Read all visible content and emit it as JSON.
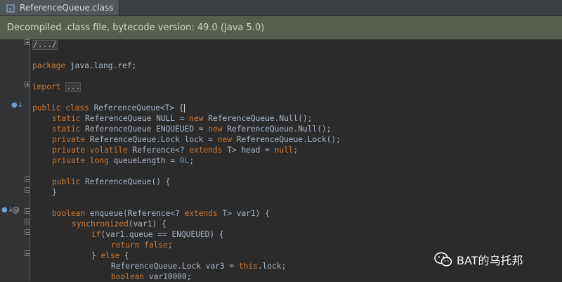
{
  "tab": {
    "label": "ReferenceQueue.class",
    "icon": "java-class-file-icon"
  },
  "banner": {
    "text": "Decompiled .class file, bytecode version: 49.0 (Java 5.0)"
  },
  "colors": {
    "keyword": "#cc7832",
    "identifier": "#a9b7c6",
    "number": "#6897bb",
    "banner_bg": "#565f4b",
    "editor_bg": "#2b2b2b"
  },
  "code": {
    "l1": "/.../",
    "l2_kw": "package",
    "l2_rest": " java.lang.ref;",
    "l3_kw": "import",
    "l3_rest": "...",
    "l4_kw": "public class",
    "l4_rest": " ReferenceQueue<T> {",
    "l5_kw1": "static",
    "l5_mid": " ReferenceQueue NULL = ",
    "l5_kw2": "new",
    "l5_rest": " ReferenceQueue.Null();",
    "l6_kw1": "static",
    "l6_mid": " ReferenceQueue ENQUEUED = ",
    "l6_kw2": "new",
    "l6_rest": " ReferenceQueue.Null();",
    "l7_kw1": "private",
    "l7_mid": " ReferenceQueue.Lock lock = ",
    "l7_kw2": "new",
    "l7_rest": " ReferenceQueue.Lock();",
    "l8_kw1": "private volatile",
    "l8_mid": " Reference<? ",
    "l8_kw2": "extends",
    "l8_mid2": " T> head = ",
    "l8_kw3": "null",
    "l8_rest": ";",
    "l9_kw1": "private long",
    "l9_mid": " queueLength = ",
    "l9_num": "0L",
    "l9_rest": ";",
    "l10_kw": "public",
    "l10_rest": " ReferenceQueue() {",
    "l11": "}",
    "l12_kw1": "boolean",
    "l12_mid": " enqueue(Reference<? ",
    "l12_kw2": "extends",
    "l12_rest": " T> var1) {",
    "l13_kw": "synchronized",
    "l13_rest": "(var1) {",
    "l14_kw": "if",
    "l14_rest": "(var1.queue == ENQUEUED) {",
    "l15_kw": "return false",
    "l15_rest": ";",
    "l16_a": "} ",
    "l16_kw": "else",
    "l16_rest": " {",
    "l17_mid": "ReferenceQueue.Lock var3 = ",
    "l17_kw": "this",
    "l17_rest": ".lock;",
    "l18_kw": "boolean",
    "l18_rest": " var10000;"
  },
  "gutter": {
    "at_symbol": "@"
  },
  "watermark": {
    "text": "BAT的乌托邦",
    "icon": "wechat-icon"
  }
}
